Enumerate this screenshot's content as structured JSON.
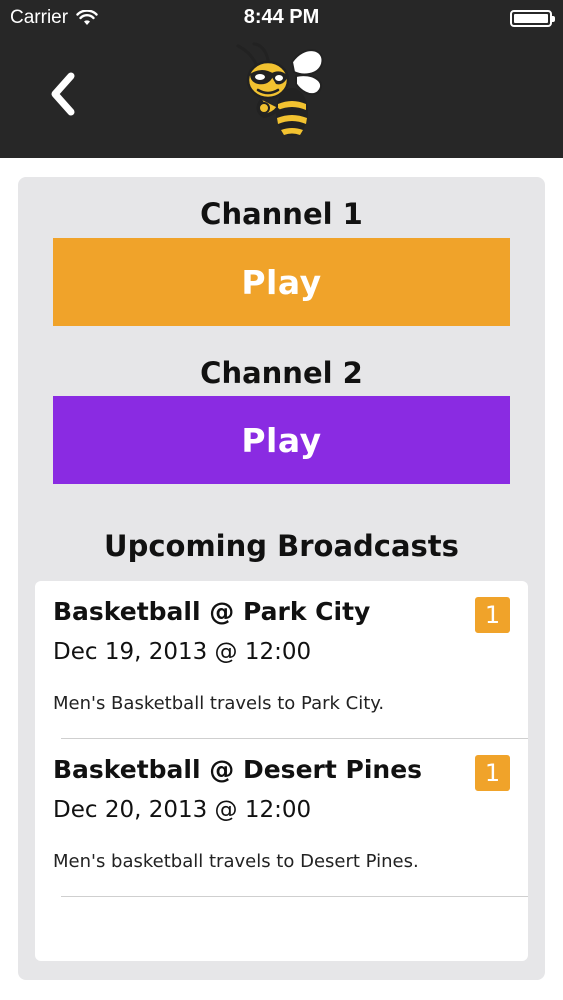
{
  "status_bar": {
    "carrier": "Carrier",
    "time": "8:44 PM"
  },
  "header": {
    "back_icon": "chevron-left-icon",
    "logo_icon": "yellow-jacket-mascot-logo"
  },
  "channels": [
    {
      "label": "Channel 1",
      "play_label": "Play",
      "color": "#f0a32a"
    },
    {
      "label": "Channel 2",
      "play_label": "Play",
      "color": "#8a2be2"
    }
  ],
  "upcoming": {
    "title": "Upcoming Broadcasts",
    "items": [
      {
        "title": "Basketball @ Park City",
        "date": "Dec 19, 2013 @ 12:00",
        "description": "Men's Basketball travels to Park City.",
        "badge": "1"
      },
      {
        "title": "Basketball @ Desert Pines",
        "date": "Dec 20, 2013 @ 12:00",
        "description": "Men's basketball travels to Desert Pines.",
        "badge": "1"
      }
    ]
  },
  "colors": {
    "header_bg": "#272727",
    "card_bg": "#e6e6e8",
    "accent_orange": "#f0a32a",
    "accent_purple": "#8a2be2"
  }
}
